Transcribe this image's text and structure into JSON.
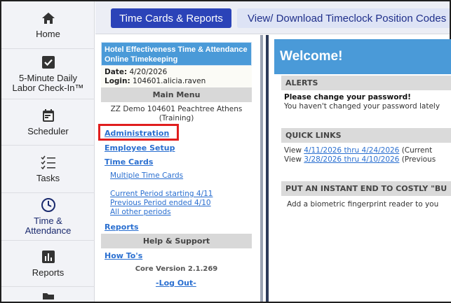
{
  "nav": {
    "items": [
      {
        "label": "Home",
        "icon": "home-icon"
      },
      {
        "label": "5-Minute Daily\nLabor Check-In™",
        "icon": "checkbox-icon"
      },
      {
        "label": "Scheduler",
        "icon": "calendar-icon"
      },
      {
        "label": "Tasks",
        "icon": "task-list-icon"
      },
      {
        "label": "Time &\nAttendance",
        "icon": "clock-icon"
      },
      {
        "label": "Reports",
        "icon": "bar-chart-icon"
      }
    ],
    "active_index": 4
  },
  "topbar": {
    "primary_button": "Time Cards & Reports",
    "secondary_button": "View/ Download Timeclock Position Codes"
  },
  "panel": {
    "title": "Hotel Effectiveness Time & Attendance Online Timekeeping",
    "date_label": "Date:",
    "date_value": "4/20/2026",
    "login_label": "Login:",
    "login_value": "104601.alicia.raven",
    "main_menu": "Main Menu",
    "location": "ZZ Demo 104601 Peachtree Athens (Training)",
    "links": {
      "administration": "Administration",
      "employee_setup": "Employee Setup",
      "time_cards": "Time Cards",
      "multiple_time_cards": "Multiple Time Cards",
      "current_period": "Current Period starting 4/11",
      "previous_period": "Previous Period ended 4/10",
      "all_other_periods": "All other periods",
      "reports": "Reports",
      "how_tos": "How To's",
      "log_out": "-Log Out-"
    },
    "help_support": "Help & Support",
    "core_version": "Core Version 2.1.269"
  },
  "content": {
    "welcome": "Welcome!",
    "alerts_header": "ALERTS",
    "alert_title": "Please change your password!",
    "alert_body": "You haven't changed your password lately",
    "quick_links_header": "QUICK LINKS",
    "view_label": "View",
    "quick_link_1": "4/11/2026 thru 4/24/2026",
    "quick_link_1_suffix": " (Current",
    "quick_link_2": "3/28/2026 thru 4/10/2026",
    "quick_link_2_suffix": " (Previous",
    "promo_header": "PUT AN INSTANT END TO COSTLY \"BU",
    "promo_body": "Add a biometric fingerprint reader to you"
  },
  "colors": {
    "primary_button": "#2b43b8",
    "header_blue": "#4a9ad8",
    "link": "#2a6fd0",
    "highlight_box": "#e01e1e"
  }
}
